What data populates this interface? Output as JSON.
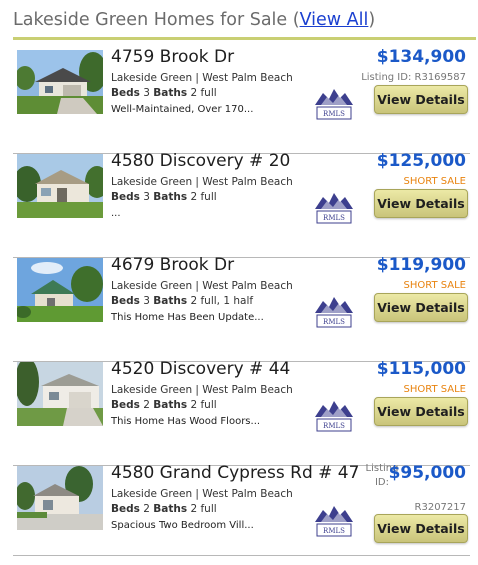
{
  "header": {
    "title": "Lakeside Green Homes for Sale",
    "open_paren": "(",
    "view_all": "View All",
    "close_paren": ")"
  },
  "listings": [
    {
      "address": "4759 Brook Dr",
      "location": "Lakeside Green | West Palm Beach",
      "beds_label": "Beds",
      "beds": "3",
      "baths_label": "Baths",
      "baths": "2 full",
      "description": "Well-Maintained, Over 170...",
      "price": "$134,900",
      "note": "Listing ID: R3169587",
      "button": "View Details"
    },
    {
      "address": "4580 Discovery # 20",
      "location": "Lakeside Green | West Palm Beach",
      "beds_label": "Beds",
      "beds": "3",
      "baths_label": "Baths",
      "baths": "2 full",
      "description": "...",
      "price": "$125,000",
      "note": "SHORT SALE",
      "button": "View Details"
    },
    {
      "address": "4679 Brook Dr",
      "location": "Lakeside Green | West Palm Beach",
      "beds_label": "Beds",
      "beds": "3",
      "baths_label": "Baths",
      "baths": "2 full, 1 half",
      "description": "This Home Has Been Update...",
      "price": "$119,900",
      "note": "SHORT SALE",
      "button": "View Details"
    },
    {
      "address": "4520 Discovery # 44",
      "location": "Lakeside Green | West Palm Beach",
      "beds_label": "Beds",
      "beds": "2",
      "baths_label": "Baths",
      "baths": "2 full",
      "description": "This Home Has Wood Floors...",
      "price": "$115,000",
      "note": "SHORT SALE",
      "button": "View Details"
    },
    {
      "address": "4580 Grand Cypress Rd # 47",
      "location": "Lakeside Green | West Palm Beach",
      "beds_label": "Beds",
      "beds": "2",
      "baths_label": "Baths",
      "baths": "2 full",
      "description": "Spacious Two Bedroom Vill...",
      "price": "$95,000",
      "listing_id_label": "Listing ID:",
      "listing_id": "R3207217",
      "button": "View Details"
    }
  ],
  "rmls_logo_text": "RMLS",
  "colors": {
    "price": "#1b59c8",
    "short_sale": "#e8830f",
    "accent_rule": "#c9cf73",
    "button": "#d9d58f"
  }
}
